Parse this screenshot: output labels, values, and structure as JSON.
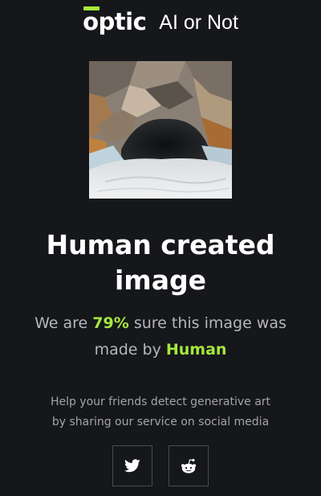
{
  "header": {
    "logo_text": "optic",
    "product_name": "AI or Not"
  },
  "result": {
    "headline_line1": "Human created",
    "headline_line2": "image",
    "confidence_prefix": "We are",
    "confidence_value": "79%",
    "confidence_middle": "sure this image was",
    "confidence_made_by": "made by",
    "confidence_label": "Human"
  },
  "share": {
    "line1": "Help your friends detect generative art",
    "line2": "by sharing our service on social media",
    "buttons": [
      {
        "icon": "twitter-icon"
      },
      {
        "icon": "reddit-icon"
      }
    ]
  },
  "colors": {
    "background": "#16171b",
    "accent": "#a6ea3c",
    "text_primary": "#ffffff",
    "text_secondary": "#b5b6ba"
  }
}
